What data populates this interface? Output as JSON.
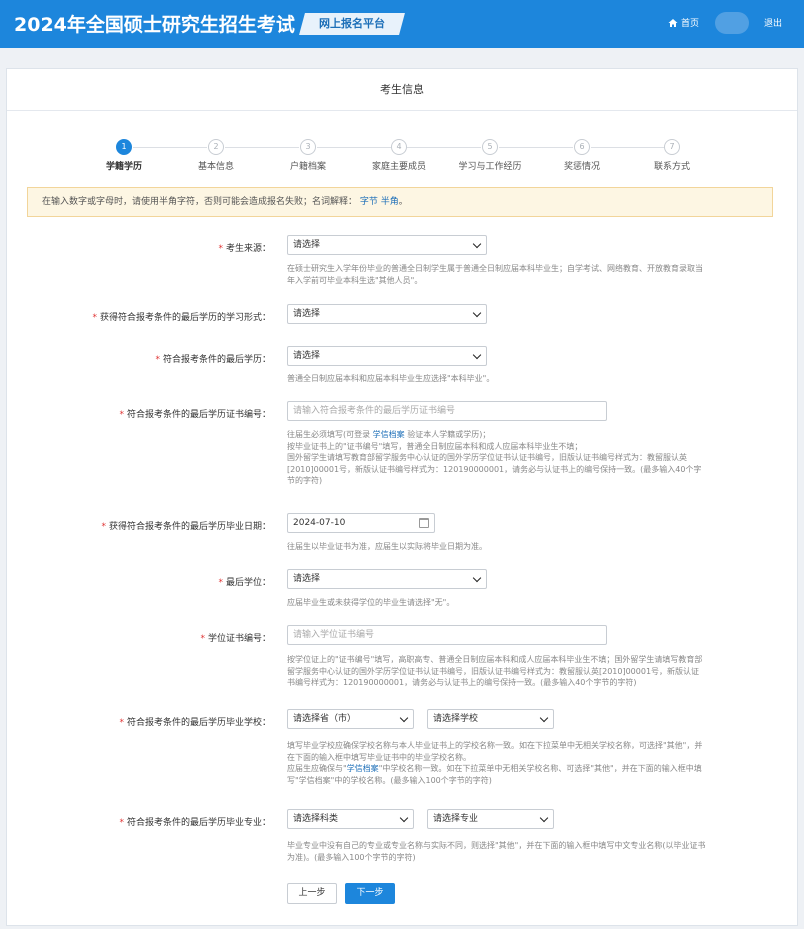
{
  "header": {
    "title": "2024年全国硕士研究生招生考试",
    "platform": "网上报名平台",
    "home": "首页",
    "logout": "退出"
  },
  "panel": {
    "title": "考生信息"
  },
  "steps": [
    {
      "num": "1",
      "label": "学籍学历",
      "active": true
    },
    {
      "num": "2",
      "label": "基本信息"
    },
    {
      "num": "3",
      "label": "户籍档案"
    },
    {
      "num": "4",
      "label": "家庭主要成员"
    },
    {
      "num": "5",
      "label": "学习与工作经历"
    },
    {
      "num": "6",
      "label": "奖惩情况"
    },
    {
      "num": "7",
      "label": "联系方式"
    }
  ],
  "notice": {
    "text": "在输入数字或字母时，请使用半角字符，否则可能会造成报名失败；名词解释：",
    "link1": "字节",
    "link2": "半角",
    "end": "。"
  },
  "form": {
    "source": {
      "label": "考生来源：",
      "value": "请选择",
      "hint": "在硕士研究生入学年份毕业的普通全日制学生属于普通全日制应届本科毕业生；自学考试、网络教育、开放教育录取当年入学前可毕业本科生选\"其他人员\"。"
    },
    "study_form": {
      "label": "获得符合报考条件的最后学历的学习形式：",
      "value": "请选择"
    },
    "last_edu": {
      "label": "符合报考条件的最后学历：",
      "value": "请选择",
      "hint": "普通全日制应届本科和应届本科毕业生应选择\"本科毕业\"。"
    },
    "cert_no": {
      "label": "符合报考条件的最后学历证书编号：",
      "placeholder": "请输入符合报考条件的最后学历证书编号",
      "hint1_pre": "往届生必须填写(可登录 ",
      "hint1_link": "学信档案",
      "hint1_post": " 验证本人学籍或学历)；",
      "hint2": "按毕业证书上的\"证书编号\"填写，普通全日制应届本科和成人应届本科毕业生不填；",
      "hint3": "国外留学生请填写教育部留学服务中心认证的国外学历学位证书认证书编号，旧版认证书编号样式为：教留服认英[2010]00001号，新版认证书编号样式为：120190000001，请务必与认证书上的编号保持一致。(最多输入40个字节的字符)"
    },
    "grad_date": {
      "label": "获得符合报考条件的最后学历毕业日期：",
      "value": "2024-07-10",
      "hint": "往届生以毕业证书为准，应届生以实际将毕业日期为准。"
    },
    "degree": {
      "label": "最后学位：",
      "value": "请选择",
      "hint": "应届毕业生或未获得学位的毕业生请选择\"无\"。"
    },
    "degree_no": {
      "label": "学位证书编号：",
      "placeholder": "请输入学位证书编号",
      "hint": "按学位证上的\"证书编号\"填写，高职高专、普通全日制应届本科和成人应届本科毕业生不填；国外留学生请填写教育部留学服务中心认证的国外学历学位证书认证书编号，旧版认证书编号样式为：教留服认英[2010]00001号，新版认证书编号样式为：120190000001，请务必与认证书上的编号保持一致。(最多输入40个字节的字符)"
    },
    "school": {
      "label": "符合报考条件的最后学历毕业学校：",
      "province": "请选择省（市）",
      "school": "请选择学校",
      "hint1": "填写毕业学校应确保学校名称与本人毕业证书上的学校名称一致。如在下拉菜单中无相关学校名称，可选择\"其他\"，并在下面的输入框中填写毕业证书中的毕业学校名称。",
      "hint2_pre": "应届生应确保与\"",
      "hint2_link": "学信档案",
      "hint2_post": "\"中学校名称一致。如在下拉菜单中无相关学校名称、可选择\"其他\"，并在下面的输入框中填写\"学信档案\"中的学校名称。(最多输入100个字节的字符)"
    },
    "major": {
      "label": "符合报考条件的最后学历毕业专业：",
      "category": "请选择科类",
      "major": "请选择专业",
      "hint": "毕业专业中没有自己的专业或专业名称与实际不同，则选择\"其他\"，并在下面的输入框中填写中文专业名称(以毕业证书为准)。(最多输入100个字节的字符)"
    }
  },
  "buttons": {
    "prev": "上一步",
    "next": "下一步"
  }
}
